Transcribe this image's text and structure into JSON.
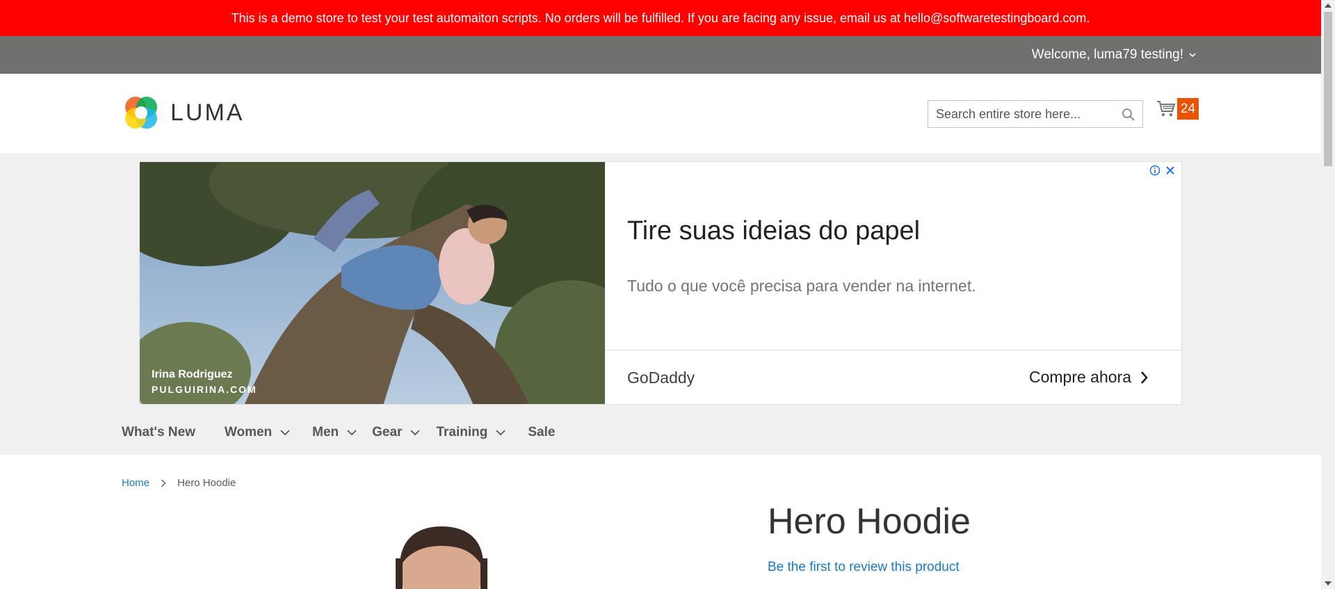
{
  "demo_notice": "This is a demo store to test your test automaiton scripts. No orders will be fulfilled. If you are facing any issue, email us at hello@softwaretestingboard.com.",
  "account": {
    "welcome": "Welcome, luma79 testing!"
  },
  "header": {
    "logo_text": "LUMA",
    "search_placeholder": "Search entire store here...",
    "cart_count": "24"
  },
  "ad": {
    "credit_name": "Irina Rodriguez",
    "credit_site": "PULGUIRINA.COM",
    "headline": "Tire suas ideias do papel",
    "subtext": "Tudo o que você precisa para vender na internet.",
    "brand": "GoDaddy",
    "cta": "Compre ahora"
  },
  "nav": {
    "items": [
      {
        "label": "What's New",
        "dropdown": false
      },
      {
        "label": "Women",
        "dropdown": true
      },
      {
        "label": "Men",
        "dropdown": true
      },
      {
        "label": "Gear",
        "dropdown": true
      },
      {
        "label": "Training",
        "dropdown": true
      },
      {
        "label": "Sale",
        "dropdown": false
      }
    ]
  },
  "breadcrumb": {
    "home": "Home",
    "current": "Hero Hoodie"
  },
  "product": {
    "title": "Hero Hoodie",
    "review_link": "Be the first to review this product"
  },
  "colors": {
    "demo_bar": "#ff0000",
    "account_bar": "#6e716e",
    "cart_badge": "#eb5202",
    "link": "#1979c3"
  }
}
